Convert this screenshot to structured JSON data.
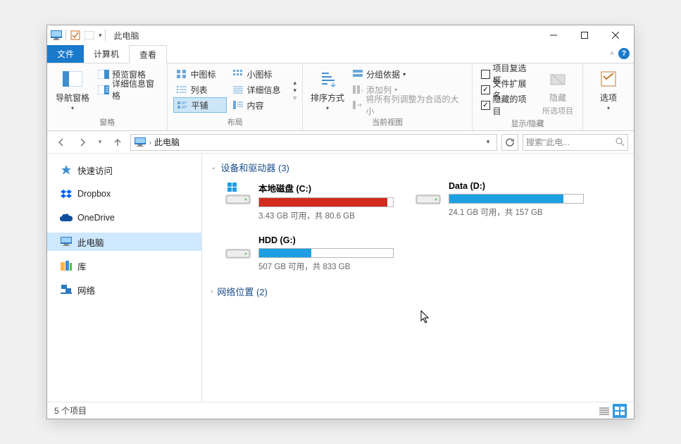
{
  "titlebar": {
    "title": "此电脑"
  },
  "tabs": {
    "file": "文件",
    "computer": "计算机",
    "view": "查看"
  },
  "ribbon": {
    "panes": {
      "nav_pane": "导航窗格",
      "preview_pane": "预览窗格",
      "details_pane": "详细信息窗格",
      "label": "窗格"
    },
    "layout": {
      "medium_icons": "中图标",
      "small_icons": "小图标",
      "list": "列表",
      "details": "详细信息",
      "tiles": "平铺",
      "content": "内容",
      "label": "布局"
    },
    "current_view": {
      "sort": "排序方式",
      "group": "分组依据",
      "add_col": "添加列",
      "fit_cols": "将所有列调整为合适的大小",
      "label": "当前视图"
    },
    "show_hide": {
      "item_cb": "项目复选框",
      "ext": "文件扩展名",
      "hidden": "隐藏的项目",
      "hide": "隐藏",
      "hide_sub": "所选项目",
      "label": "显示/隐藏"
    },
    "options": {
      "label": "选项"
    }
  },
  "nav": {
    "address": "此电脑",
    "search_placeholder": "搜索\"此电..."
  },
  "sidebar": {
    "items": [
      {
        "label": "快速访问"
      },
      {
        "label": "Dropbox"
      },
      {
        "label": "OneDrive"
      },
      {
        "label": "此电脑"
      },
      {
        "label": "库"
      },
      {
        "label": "网络"
      }
    ]
  },
  "content": {
    "devices_header": "设备和驱动器 (3)",
    "network_header": "网络位置 (2)",
    "drives": [
      {
        "name": "本地磁盘 (C:)",
        "stat": "3.43 GB 可用，共 80.6 GB",
        "fill_pct": 96,
        "color": "#d22a1d",
        "os": true
      },
      {
        "name": "Data (D:)",
        "stat": "24.1 GB 可用，共 157 GB",
        "fill_pct": 85,
        "color": "#1ca0e3",
        "os": false
      },
      {
        "name": "HDD (G:)",
        "stat": "507 GB 可用，共 833 GB",
        "fill_pct": 39,
        "color": "#1ca0e3",
        "os": false
      }
    ]
  },
  "status": {
    "count": "5 个项目"
  }
}
